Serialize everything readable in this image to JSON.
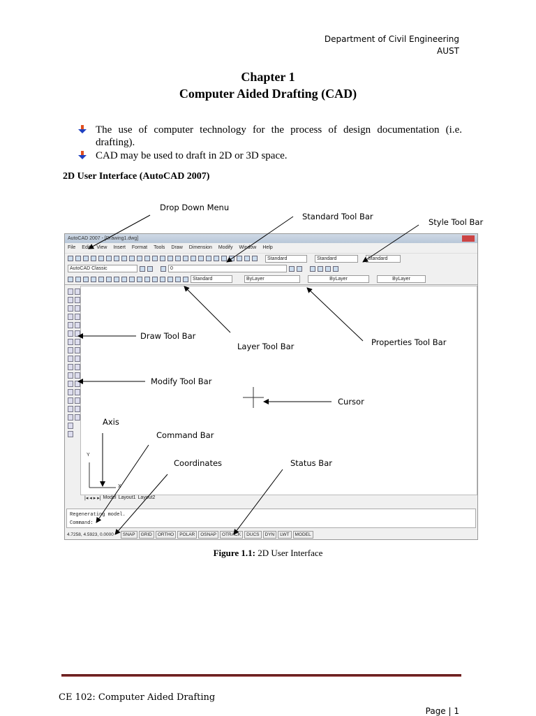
{
  "header": {
    "line1": "Department of Civil Engineering",
    "line2": "AUST"
  },
  "title": {
    "chapter": "Chapter 1",
    "subject": "Computer Aided Drafting (CAD)"
  },
  "bullets": [
    "The use of computer technology for the process of design documentation (i.e. drafting).",
    "CAD may be used to draft in 2D or 3D space."
  ],
  "section_heading": "2D User Interface (AutoCAD 2007)",
  "figure": {
    "window_title": "AutoCAD 2007 - [Drawing1.dwg]",
    "menu": [
      "File",
      "Edit",
      "View",
      "Insert",
      "Format",
      "Tools",
      "Draw",
      "Dimension",
      "Modify",
      "Window",
      "Help"
    ],
    "style_dropdowns": [
      "Standard",
      "Standard",
      "Standard"
    ],
    "workspace": "AutoCAD Classic",
    "layer": "0",
    "dim_style": "Standard",
    "properties": [
      "ByLayer",
      "ByLayer",
      "ByLayer"
    ],
    "tabs": [
      "Model",
      "Layout1",
      "Layout2"
    ],
    "command_history": "Regenerating model.",
    "command_prompt": "Command:",
    "coordinates": "4.7258, 4.5923, 0.0000",
    "status_buttons": [
      "SNAP",
      "GRID",
      "ORTHO",
      "POLAR",
      "OSNAP",
      "OTRACK",
      "DUCS",
      "DYN",
      "LWT",
      "MODEL"
    ],
    "axis_y": "Y",
    "axis_x": "X",
    "annotations": {
      "drop_down": "Drop Down Menu",
      "standard": "Standard Tool Bar",
      "style": "Style Tool Bar",
      "draw": "Draw Tool Bar",
      "layer": "Layer Tool Bar",
      "properties": "Properties Tool Bar",
      "modify": "Modify Tool Bar",
      "cursor": "Cursor",
      "axis": "Axis",
      "command": "Command Bar",
      "coordinates": "Coordinates",
      "status": "Status Bar"
    },
    "caption_label": "Figure 1.1:",
    "caption_text": " 2D User Interface"
  },
  "footer": {
    "course": "CE 102: Computer Aided Drafting",
    "page": "Page | 1"
  },
  "colors": {
    "rule": "#6b1f1f"
  }
}
